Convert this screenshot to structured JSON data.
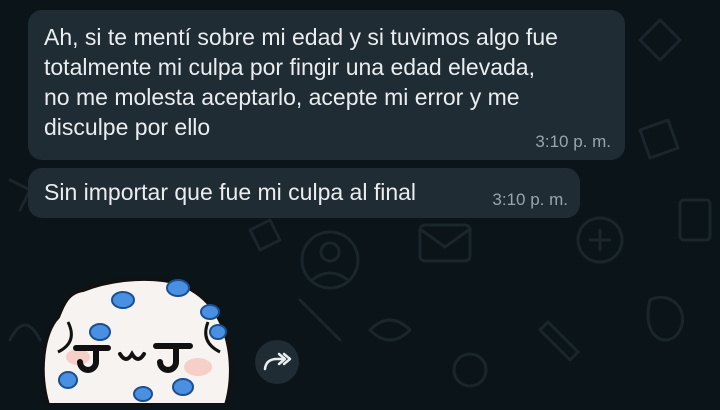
{
  "messages": [
    {
      "text": "Ah, si te mentí sobre mi edad y si tuvimos algo fue totalmente mi culpa por fingir una edad elevada, no me molesta aceptarlo, acepte mi error y me disculpe por ello",
      "time": "3:10 p. m."
    },
    {
      "text": "Sin importar que fue mi culpa al final",
      "time": "3:10 p. m."
    }
  ],
  "sticker": {
    "icon": "cat-sticker"
  },
  "forward": {
    "icon": "forward-icon"
  },
  "colors": {
    "background": "#0b1418",
    "bubble": "#1f2c33",
    "text": "#e9edef",
    "timestamp": "#9aa4aa",
    "sticker_accent": "#4a90e2"
  }
}
